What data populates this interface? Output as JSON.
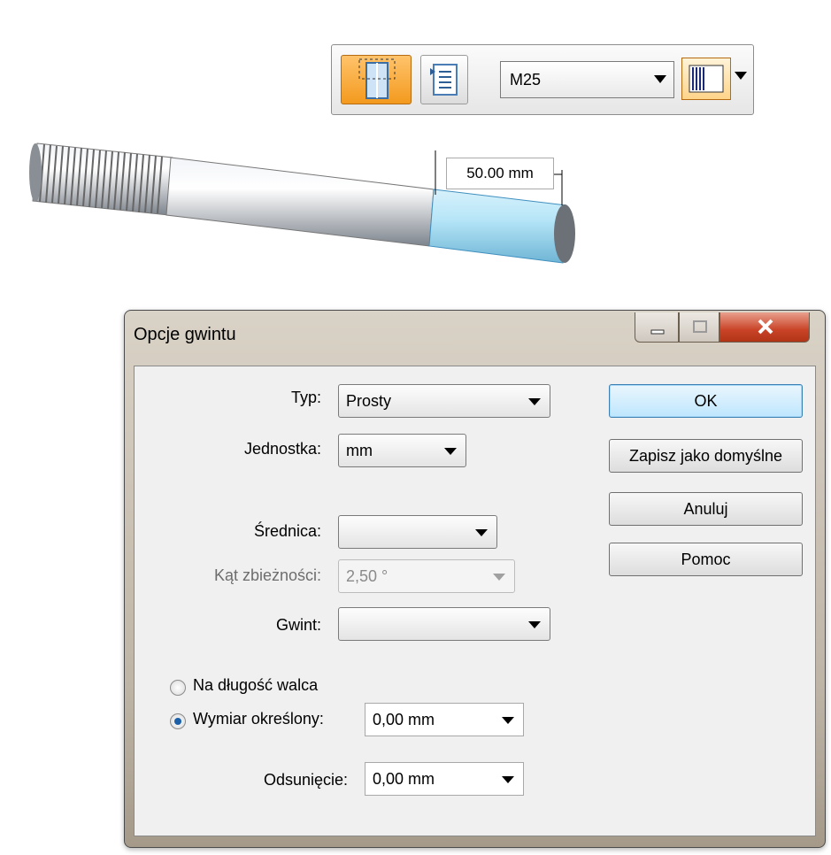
{
  "ribbon": {
    "thread_button": "thread-feature-icon",
    "properties_button": "properties-list-icon",
    "thread_size": "M25",
    "fill_style_icon": "thread-fill-style-icon"
  },
  "model": {
    "dimension_label": "50.00 mm"
  },
  "dialog": {
    "title": "Opcje gwintu",
    "fields": {
      "typ_label": "Typ:",
      "typ_value": "Prosty",
      "jednostka_label": "Jednostka:",
      "jednostka_value": "mm",
      "srednica_label": "Średnica:",
      "srednica_value": "",
      "kat_label": "Kąt zbieżności:",
      "kat_value": "2,50 °",
      "gwint_label": "Gwint:",
      "gwint_value": ""
    },
    "radios": {
      "na_dlugosc": "Na długość walca",
      "wymiar": "Wymiar określony:",
      "wymiar_value": "0,00 mm",
      "selected": "wymiar"
    },
    "odsuniecie_label": "Odsunięcie:",
    "odsuniecie_value": "0,00 mm",
    "buttons": {
      "ok": "OK",
      "save_default": "Zapisz jako domyślne",
      "cancel": "Anuluj",
      "help": "Pomoc"
    }
  },
  "colors": {
    "accent_orange": "#f39a1e",
    "selected_face": "#a6dcf2",
    "close_red": "#c94327"
  }
}
